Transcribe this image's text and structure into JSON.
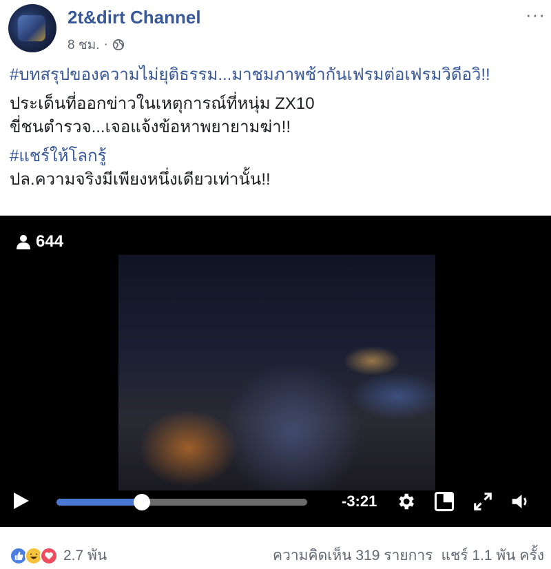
{
  "post": {
    "page_name": "2t&dirt Channel",
    "time": "8 ชม.",
    "separator": "·",
    "privacy_icon": "globe-icon",
    "more_icon": "more-options-icon",
    "more_label": "···",
    "text": {
      "line1": "#บทสรุปของความไม่ยุติธรรม...มาชมภาพช้ากันเฟรมต่อเฟรมวิดีอวิ!!",
      "line2": "ประเด็นที่ออกข่าวในเหตุการณ์ที่หนุ่ม ZX10",
      "line3": "ขี่ชนตำรวจ...เจอแจ้งข้อหาพยายามฆ่า!!",
      "line4": "#แชร์ให้โลกรู้",
      "line5": "ปล.ความจริงมีเพียงหนึ่งเดียวเท่านั้น!!"
    }
  },
  "video": {
    "viewer_count": "644",
    "viewer_icon": "person-icon",
    "progress": 0.34,
    "time_remaining": "-3:21",
    "controls": [
      "play-icon",
      "gear-icon",
      "pip-icon",
      "fullscreen-icon",
      "volume-icon"
    ]
  },
  "footer": {
    "reaction_icons": [
      "like-icon",
      "haha-icon",
      "love-icon"
    ],
    "reaction_count": "2.7 พัน",
    "comments": "ความคิดเห็น 319 รายการ",
    "shares": "แชร์ 1.1 พัน ครั้ง"
  },
  "colors": {
    "link": "#385898",
    "progress": "#4a76d4",
    "like": "#4a7ee0",
    "haha": "#f5c33b",
    "love": "#ed4d5f"
  }
}
